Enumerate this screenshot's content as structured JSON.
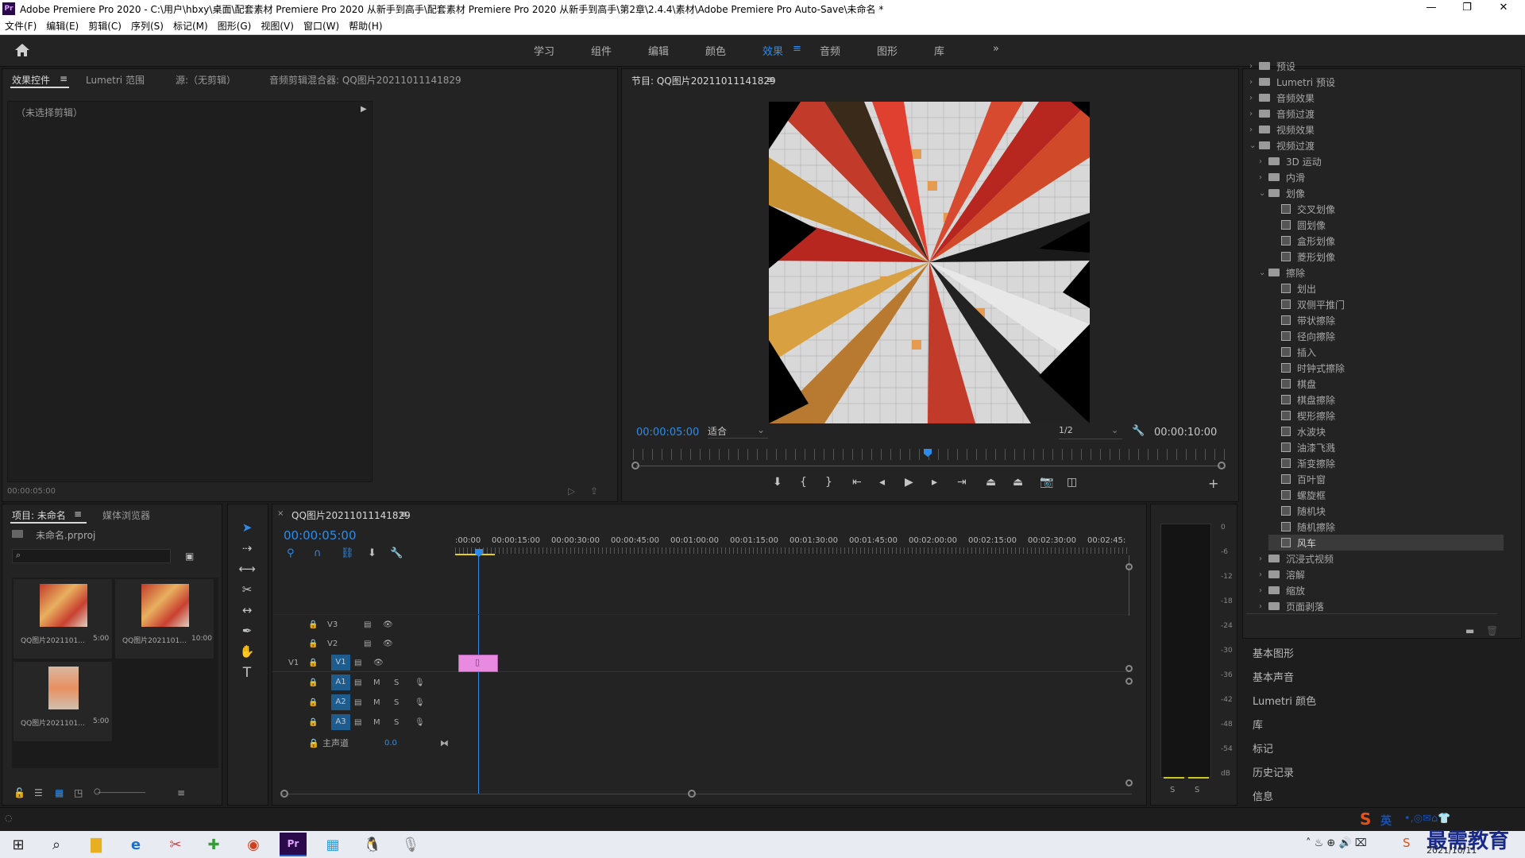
{
  "window": {
    "title": "Adobe Premiere Pro 2020 - C:\\用户\\hbxy\\桌面\\配套素材 Premiere Pro 2020 从新手到高手\\配套素材 Premiere Pro 2020 从新手到高手\\第2章\\2.4.4\\素材\\Adobe Premiere Pro Auto-Save\\未命名 *",
    "app_badge": "Pr",
    "minimize": "—",
    "restore": "❐",
    "close": "✕"
  },
  "menu": [
    "文件(F)",
    "编辑(E)",
    "剪辑(C)",
    "序列(S)",
    "标记(M)",
    "图形(G)",
    "视图(V)",
    "窗口(W)",
    "帮助(H)"
  ],
  "workspaces": {
    "items": [
      "学习",
      "组件",
      "编辑",
      "颜色",
      "效果",
      "音频",
      "图形",
      "库"
    ],
    "active": "效果",
    "more": "»",
    "menu_glyph": "≡"
  },
  "source_panel": {
    "tabs": [
      "效果控件",
      "Lumetri 范围",
      "源:（无剪辑）",
      "音频剪辑混合器: QQ图片20211011141829"
    ],
    "no_clip": "（未选择剪辑）",
    "timecode": "00:00:05:00"
  },
  "program": {
    "title": "节目: QQ图片20211011141829",
    "timecode": "00:00:05:00",
    "fit": "适合",
    "resolution": "1/2",
    "duration": "00:00:10:00"
  },
  "project": {
    "tabs": [
      "项目: 未命名",
      "媒体浏览器"
    ],
    "file": "未命名.prproj",
    "items": [
      {
        "name": "QQ图片2021101...",
        "dur": "5:00"
      },
      {
        "name": "QQ图片2021101...",
        "dur": "10:00"
      },
      {
        "name": "QQ图片2021101...",
        "dur": "5:00"
      }
    ]
  },
  "timeline": {
    "sequence": "QQ图片20211011141829",
    "timecode": "00:00:05:00",
    "ruler": [
      ":00:00",
      "00:00:15:00",
      "00:00:30:00",
      "00:00:45:00",
      "00:01:00:00",
      "00:01:15:00",
      "00:01:30:00",
      "00:01:45:00",
      "00:02:00:00",
      "00:02:15:00",
      "00:02:30:00",
      "00:02:45:"
    ],
    "video_tracks": [
      "V3",
      "V2",
      "V1"
    ],
    "audio_tracks": [
      "A1",
      "A2",
      "A3"
    ],
    "source_patch": "V1",
    "master": "主声道",
    "master_val": "0.0",
    "m": "M",
    "s": "S"
  },
  "meter": {
    "scale": [
      "0",
      "-6",
      "-12",
      "-18",
      "-24",
      "-30",
      "-36",
      "-42",
      "-48",
      "-54",
      "dB"
    ],
    "s_left": "S",
    "s_right": "S"
  },
  "effects": {
    "rows": [
      {
        "level": 0,
        "kind": "folder",
        "label": "预设",
        "chev": "›"
      },
      {
        "level": 0,
        "kind": "folder",
        "label": "Lumetri 预设",
        "chev": "›"
      },
      {
        "level": 0,
        "kind": "folder",
        "label": "音频效果",
        "chev": "›"
      },
      {
        "level": 0,
        "kind": "folder",
        "label": "音频过渡",
        "chev": "›"
      },
      {
        "level": 0,
        "kind": "folder",
        "label": "视频效果",
        "chev": "›"
      },
      {
        "level": 0,
        "kind": "folder",
        "label": "视频过渡",
        "chev": "⌄"
      },
      {
        "level": 1,
        "kind": "folder",
        "label": "3D 运动",
        "chev": "›"
      },
      {
        "level": 1,
        "kind": "folder",
        "label": "内滑",
        "chev": "›"
      },
      {
        "level": 1,
        "kind": "folder",
        "label": "划像",
        "chev": "⌄"
      },
      {
        "level": 2,
        "kind": "fx",
        "label": "交叉划像",
        "chev": ""
      },
      {
        "level": 2,
        "kind": "fx",
        "label": "圆划像",
        "chev": ""
      },
      {
        "level": 2,
        "kind": "fx",
        "label": "盒形划像",
        "chev": ""
      },
      {
        "level": 2,
        "kind": "fx",
        "label": "菱形划像",
        "chev": ""
      },
      {
        "level": 1,
        "kind": "folder",
        "label": "擦除",
        "chev": "⌄"
      },
      {
        "level": 2,
        "kind": "fx",
        "label": "划出",
        "chev": ""
      },
      {
        "level": 2,
        "kind": "fx",
        "label": "双侧平推门",
        "chev": ""
      },
      {
        "level": 2,
        "kind": "fx",
        "label": "带状擦除",
        "chev": ""
      },
      {
        "level": 2,
        "kind": "fx",
        "label": "径向擦除",
        "chev": ""
      },
      {
        "level": 2,
        "kind": "fx",
        "label": "插入",
        "chev": ""
      },
      {
        "level": 2,
        "kind": "fx",
        "label": "时钟式擦除",
        "chev": ""
      },
      {
        "level": 2,
        "kind": "fx",
        "label": "棋盘",
        "chev": ""
      },
      {
        "level": 2,
        "kind": "fx",
        "label": "棋盘擦除",
        "chev": ""
      },
      {
        "level": 2,
        "kind": "fx",
        "label": "楔形擦除",
        "chev": ""
      },
      {
        "level": 2,
        "kind": "fx",
        "label": "水波块",
        "chev": ""
      },
      {
        "level": 2,
        "kind": "fx",
        "label": "油漆飞溅",
        "chev": ""
      },
      {
        "level": 2,
        "kind": "fx",
        "label": "渐变擦除",
        "chev": ""
      },
      {
        "level": 2,
        "kind": "fx",
        "label": "百叶窗",
        "chev": ""
      },
      {
        "level": 2,
        "kind": "fx",
        "label": "螺旋框",
        "chev": ""
      },
      {
        "level": 2,
        "kind": "fx",
        "label": "随机块",
        "chev": ""
      },
      {
        "level": 2,
        "kind": "fx",
        "label": "随机擦除",
        "chev": ""
      },
      {
        "level": 2,
        "kind": "fx",
        "label": "风车",
        "chev": "",
        "selected": true
      },
      {
        "level": 1,
        "kind": "folder",
        "label": "沉浸式视频",
        "chev": "›"
      },
      {
        "level": 1,
        "kind": "folder",
        "label": "溶解",
        "chev": "›"
      },
      {
        "level": 1,
        "kind": "folder",
        "label": "缩放",
        "chev": "›"
      },
      {
        "level": 1,
        "kind": "folder",
        "label": "页面剥落",
        "chev": "›"
      }
    ]
  },
  "side_panels": [
    "基本图形",
    "基本声音",
    "Lumetri 颜色",
    "库",
    "标记",
    "历史记录",
    "信息"
  ],
  "taskbar": {
    "ime": "英",
    "watermark": "最需教育",
    "date": "2021/10/11"
  },
  "colors": {
    "accent": "#2d8ceb",
    "clip": "#e78ae0",
    "panel": "#232323",
    "bg": "#1d1d1d"
  }
}
